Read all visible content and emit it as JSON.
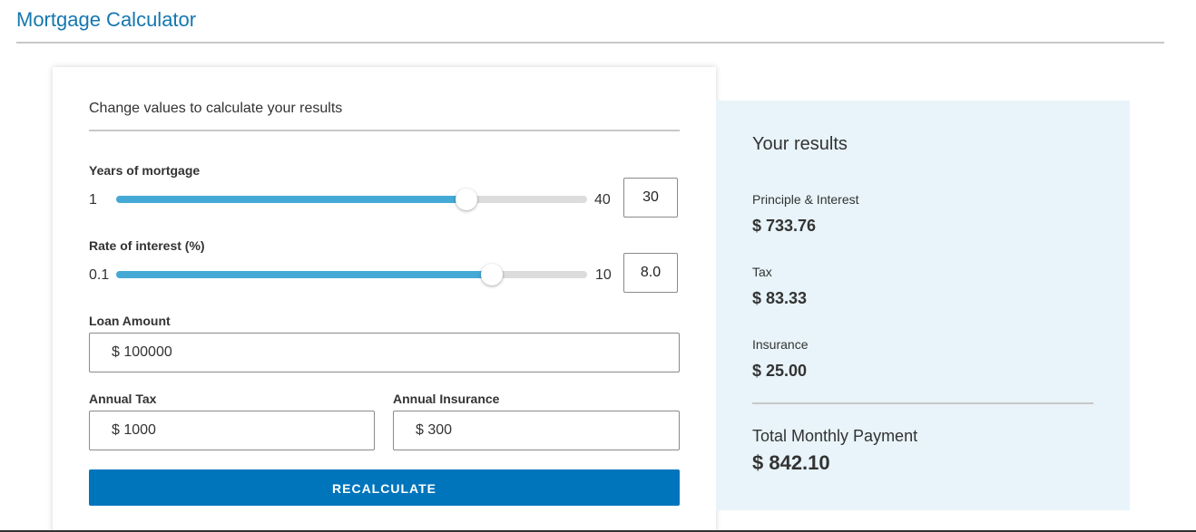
{
  "page": {
    "title": "Mortgage Calculator"
  },
  "form": {
    "heading": "Change values to calculate your results",
    "years": {
      "label": "Years of mortgage",
      "min": "1",
      "max": "40",
      "value": "30",
      "fill_fraction": 0.744
    },
    "interest": {
      "label": "Rate of interest (%)",
      "min": "0.1",
      "max": "10",
      "value": "8.0",
      "fill_fraction": 0.798
    },
    "loan_amount": {
      "label": "Loan Amount",
      "value": "$ 100000"
    },
    "annual_tax": {
      "label": "Annual Tax",
      "value": "$ 1000"
    },
    "annual_insurance": {
      "label": "Annual Insurance",
      "value": "$ 300"
    },
    "recalculate_label": "RECALCULATE"
  },
  "results": {
    "heading": "Your results",
    "principle_interest": {
      "label": "Principle & Interest",
      "value": "$ 733.76"
    },
    "tax": {
      "label": "Tax",
      "value": "$ 83.33"
    },
    "insurance": {
      "label": "Insurance",
      "value": "$ 25.00"
    },
    "total": {
      "label": "Total Monthly Payment",
      "value": "$ 842.10"
    }
  },
  "colors": {
    "title": "#1577b0",
    "slider_fill": "#45a9d5",
    "button": "#0075bc",
    "results_bg": "#e8f4f9"
  }
}
